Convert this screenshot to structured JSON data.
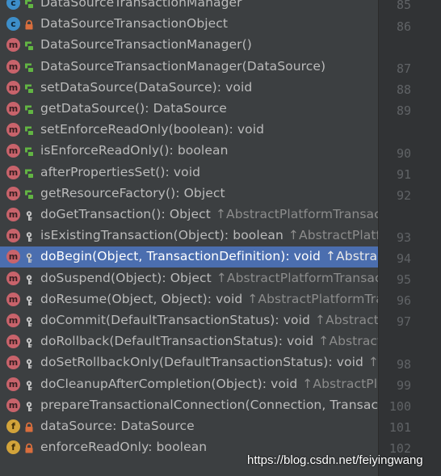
{
  "structure_popup": {
    "items": [
      {
        "kind": "c",
        "kind_letter": "c",
        "visibility": "public",
        "name": "DataSourceTransactionManager",
        "inherited": ""
      },
      {
        "kind": "c",
        "kind_letter": "c",
        "visibility": "private",
        "name": "DataSourceTransactionObject",
        "inherited": ""
      },
      {
        "kind": "m",
        "kind_letter": "m",
        "visibility": "public",
        "name": "DataSourceTransactionManager()",
        "inherited": ""
      },
      {
        "kind": "m",
        "kind_letter": "m",
        "visibility": "public",
        "name": "DataSourceTransactionManager(DataSource)",
        "inherited": ""
      },
      {
        "kind": "m",
        "kind_letter": "m",
        "visibility": "public",
        "name": "setDataSource(DataSource): void",
        "inherited": ""
      },
      {
        "kind": "m",
        "kind_letter": "m",
        "visibility": "public",
        "name": "getDataSource(): DataSource",
        "inherited": ""
      },
      {
        "kind": "m",
        "kind_letter": "m",
        "visibility": "public",
        "name": "setEnforceReadOnly(boolean): void",
        "inherited": ""
      },
      {
        "kind": "m",
        "kind_letter": "m",
        "visibility": "public",
        "name": "isEnforceReadOnly(): boolean",
        "inherited": ""
      },
      {
        "kind": "m",
        "kind_letter": "m",
        "visibility": "public",
        "name": "afterPropertiesSet(): void",
        "inherited": ""
      },
      {
        "kind": "m",
        "kind_letter": "m",
        "visibility": "public",
        "name": "getResourceFactory(): Object",
        "inherited": ""
      },
      {
        "kind": "m",
        "kind_letter": "m",
        "visibility": "protected",
        "name": "doGetTransaction(): Object",
        "inherited": "↑AbstractPlatformTransactio"
      },
      {
        "kind": "m",
        "kind_letter": "m",
        "visibility": "protected",
        "name": "isExistingTransaction(Object): boolean",
        "inherited": "↑AbstractPlatform"
      },
      {
        "kind": "m",
        "kind_letter": "m",
        "visibility": "protected",
        "name": "doBegin(Object, TransactionDefinition): void",
        "inherited": "↑AbstractP",
        "selected": true
      },
      {
        "kind": "m",
        "kind_letter": "m",
        "visibility": "protected",
        "name": "doSuspend(Object): Object",
        "inherited": "↑AbstractPlatformTransactio"
      },
      {
        "kind": "m",
        "kind_letter": "m",
        "visibility": "protected",
        "name": "doResume(Object, Object): void",
        "inherited": "↑AbstractPlatformTrans"
      },
      {
        "kind": "m",
        "kind_letter": "m",
        "visibility": "protected",
        "name": "doCommit(DefaultTransactionStatus): void",
        "inherited": "↑AbstractPla"
      },
      {
        "kind": "m",
        "kind_letter": "m",
        "visibility": "protected",
        "name": "doRollback(DefaultTransactionStatus): void",
        "inherited": "↑AbstractPl"
      },
      {
        "kind": "m",
        "kind_letter": "m",
        "visibility": "protected",
        "name": "doSetRollbackOnly(DefaultTransactionStatus): void",
        "inherited": "↑Ab"
      },
      {
        "kind": "m",
        "kind_letter": "m",
        "visibility": "protected",
        "name": "doCleanupAfterCompletion(Object): void",
        "inherited": "↑AbstractPlat"
      },
      {
        "kind": "m",
        "kind_letter": "m",
        "visibility": "protected",
        "name": "prepareTransactionalConnection(Connection, Transacti",
        "inherited": ""
      },
      {
        "kind": "f",
        "kind_letter": "f",
        "visibility": "private",
        "name": "dataSource: DataSource",
        "inherited": ""
      },
      {
        "kind": "f",
        "kind_letter": "f",
        "visibility": "private",
        "name": "enforceReadOnly: boolean",
        "inherited": ""
      }
    ]
  },
  "gutter": {
    "line_numbers": [
      "85",
      "86",
      "87",
      "88",
      "89",
      "90",
      "91",
      "92",
      "93",
      "94",
      "95",
      "96",
      "97",
      "98",
      "99",
      "100",
      "101",
      "102"
    ]
  },
  "colors": {
    "popup_background": "#3c3f41",
    "selection": "#4b6eaf",
    "method_icon": "#c8636b",
    "class_icon": "#3d8ec9",
    "field_icon": "#d2a33a",
    "public_visibility": "#62b543",
    "private_visibility": "#d96e3d",
    "protected_visibility": "#c5c5c5"
  },
  "watermark": "https://blog.csdn.net/feiyingwang"
}
